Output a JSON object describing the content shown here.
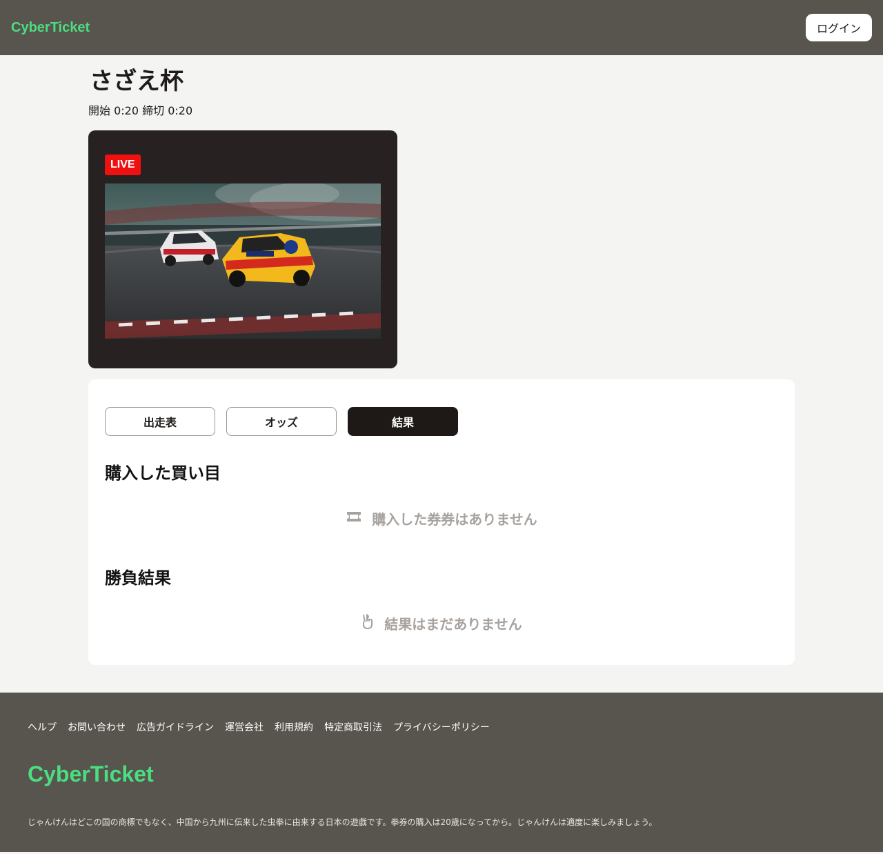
{
  "header": {
    "logo": "CyberTicket",
    "login_label": "ログイン"
  },
  "event": {
    "title": "さざえ杯",
    "meta": "開始 0:20 締切 0:20"
  },
  "live": {
    "badge": "LIVE"
  },
  "tabs": [
    {
      "label": "出走表",
      "active": false
    },
    {
      "label": "オッズ",
      "active": false
    },
    {
      "label": "結果",
      "active": true
    }
  ],
  "purchased": {
    "title": "購入した買い目",
    "empty_text": "購入した券券はありません",
    "icon": "ticket-icon"
  },
  "results": {
    "title": "勝負結果",
    "empty_text": "結果はまだありません",
    "icon": "hand-peace-icon"
  },
  "footer": {
    "links": [
      "ヘルプ",
      "お問い合わせ",
      "広告ガイドライン",
      "運営会社",
      "利用規約",
      "特定商取引法",
      "プライバシーポリシー"
    ],
    "logo": "CyberTicket",
    "note": "じゃんけんはどこの国の商標でもなく、中国から九州に伝来した虫拳に由来する日本の遊戯です。拳券の購入は20歳になってから。じゃんけんは適度に楽しみましょう。"
  },
  "colors": {
    "accent": "#4ade80",
    "live": "#f01010",
    "header_bg": "#58554f"
  }
}
